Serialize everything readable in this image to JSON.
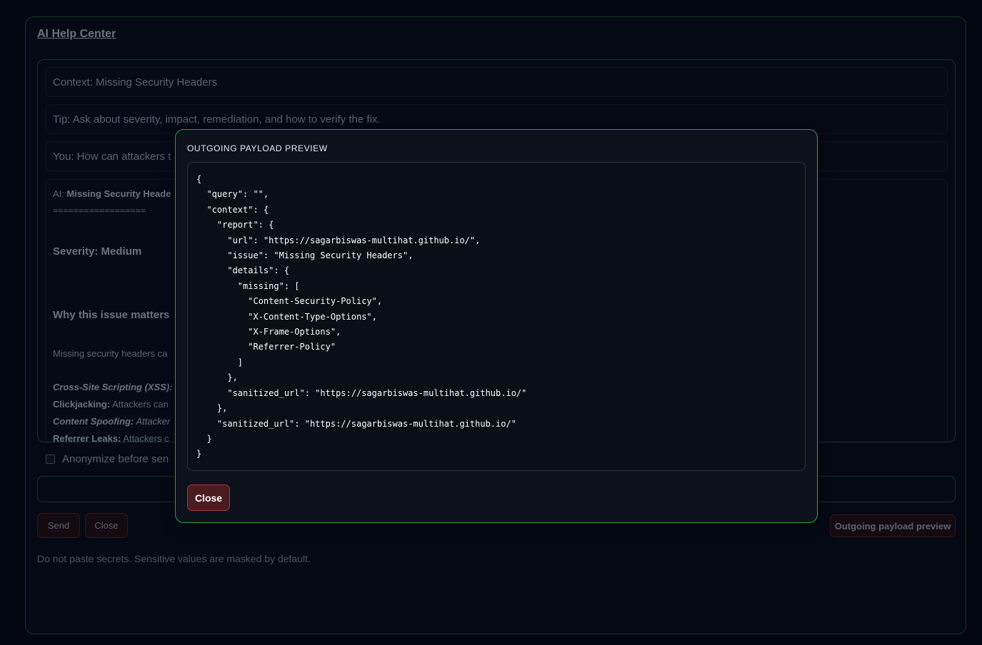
{
  "app": {
    "title": "AI Help Center"
  },
  "chat": {
    "context": "Context: Missing Security Headers",
    "tip": "Tip: Ask about severity, impact, remediation, and how to verify the fix.",
    "user_message": "You: How can attackers t",
    "ai": {
      "prefix": "AI: ",
      "heading": "Missing Security Heade",
      "separator": "==================",
      "severity": "Severity: Medium",
      "why_heading": "Why this issue matters",
      "description": "Missing security headers ca",
      "bullets": [
        {
          "term": "Cross-Site Scripting (XSS):",
          "text": "",
          "term_italic": true
        },
        {
          "term": "Clickjacking:",
          "text": " Attackers can",
          "term_italic": false
        },
        {
          "term": "Content Spoofing:",
          "text": " Attacker",
          "term_italic": true
        },
        {
          "term": "Referrer Leaks:",
          "text": " Attackers c",
          "term_italic": false
        }
      ]
    }
  },
  "anonymize": {
    "label": "Anonymize before sen",
    "checked": false
  },
  "input": {
    "value": "",
    "placeholder": ""
  },
  "buttons": {
    "send": "Send",
    "close": "Close",
    "preview": "Outgoing payload preview"
  },
  "note": "Do not paste secrets. Sensitive values are masked by default.",
  "modal": {
    "title": "OUTGOING PAYLOAD PREVIEW",
    "payload": "{\n  \"query\": \"\",\n  \"context\": {\n    \"report\": {\n      \"url\": \"https://sagarbiswas-multihat.github.io/\",\n      \"issue\": \"Missing Security Headers\",\n      \"details\": {\n        \"missing\": [\n          \"Content-Security-Policy\",\n          \"X-Content-Type-Options\",\n          \"X-Frame-Options\",\n          \"Referrer-Policy\"\n        ]\n      },\n      \"sanitized_url\": \"https://sagarbiswas-multihat.github.io/\"\n    },\n    \"sanitized_url\": \"https://sagarbiswas-multihat.github.io/\"\n  }\n}",
    "close_label": "Close"
  },
  "colors": {
    "accent_border": "#2ea043",
    "danger_button": "#4a1c20",
    "background": "#020611"
  }
}
